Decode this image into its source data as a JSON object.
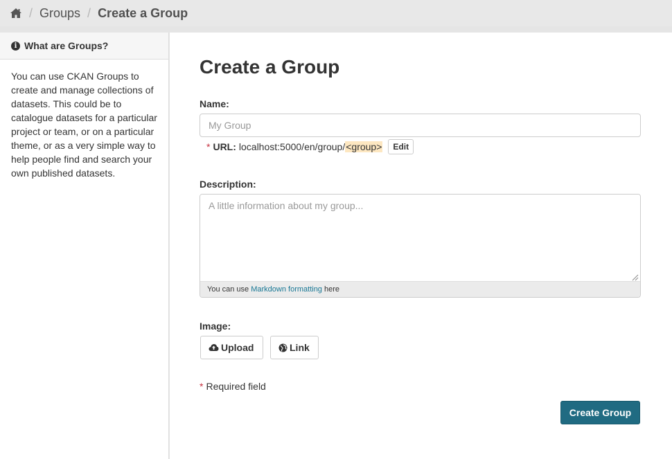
{
  "breadcrumb": {
    "home_icon": "home-icon",
    "items": [
      "Groups",
      "Create a Group"
    ],
    "separator": "/"
  },
  "sidebar": {
    "icon": "info-icon",
    "icon_glyph": "i",
    "title": "What are Groups?",
    "body": "You can use CKAN Groups to create and manage collections of datasets. This could be to catalogue datasets for a particular project or team, or on a particular theme, or as a very simple way to help people find and search your own published datasets."
  },
  "form": {
    "title": "Create a Group",
    "name_label": "Name:",
    "name_placeholder": "My Group",
    "name_value": "",
    "url_required_mark": "*",
    "url_label": "URL:",
    "url_prefix": "localhost:5000/en/group/",
    "url_slug": "<group>",
    "edit_label": "Edit",
    "description_label": "Description:",
    "description_placeholder": "A little information about my group...",
    "description_value": "",
    "markdown_help_prefix": "You can use",
    "markdown_link": "Markdown formatting",
    "markdown_help_suffix": "here",
    "image_label": "Image:",
    "upload_label": "Upload",
    "upload_icon": "cloud-upload-icon",
    "link_label": "Link",
    "link_icon": "globe-icon",
    "required_mark": "*",
    "required_note": "Required field",
    "submit_label": "Create Group"
  },
  "colors": {
    "primary": "#206b82",
    "link": "#187794",
    "required": "#c6303e",
    "slug_highlight": "#fde7c1"
  }
}
